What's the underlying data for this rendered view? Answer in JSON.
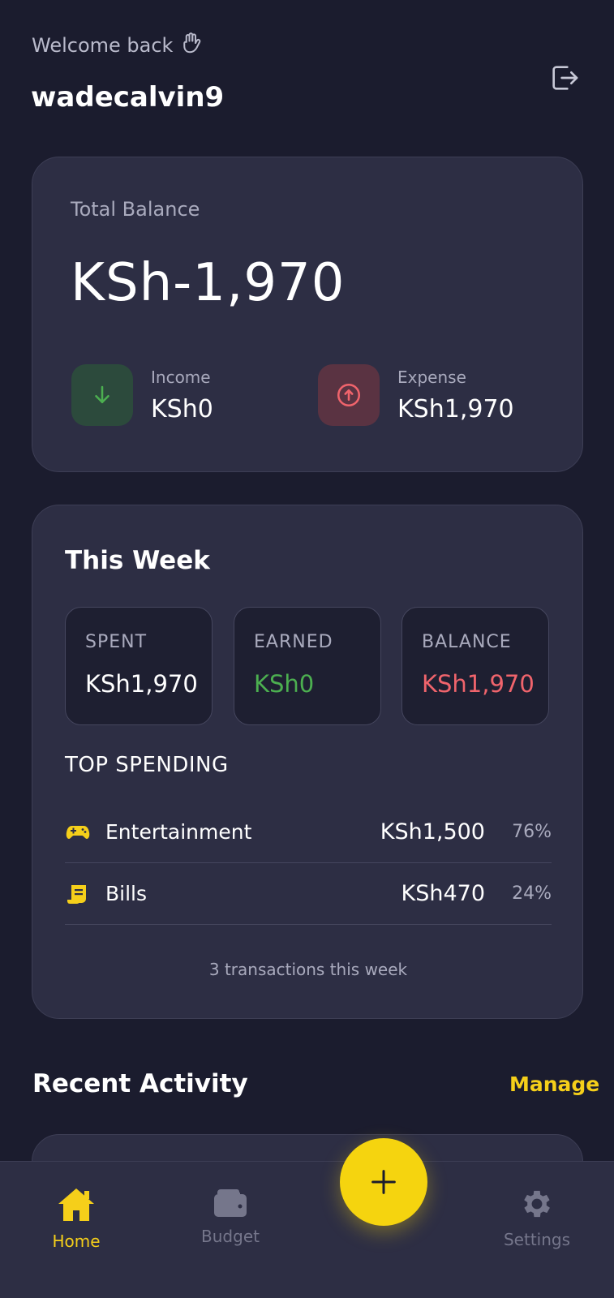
{
  "header": {
    "welcome": "Welcome back",
    "username": "wadecalvin9"
  },
  "balance": {
    "label": "Total Balance",
    "amount": "KSh-1,970",
    "income_label": "Income",
    "income_value": "KSh0",
    "expense_label": "Expense",
    "expense_value": "KSh1,970"
  },
  "week": {
    "title": "This Week",
    "spent_label": "SPENT",
    "spent_value": "KSh1,970",
    "earned_label": "EARNED",
    "earned_value": "KSh0",
    "balance_label": "BALANCE",
    "balance_value": "KSh1,970",
    "top_title": "TOP SPENDING",
    "top": [
      {
        "name": "Entertainment",
        "amount": "KSh1,500",
        "pct": "76%",
        "icon": "gamepad-icon"
      },
      {
        "name": "Bills",
        "amount": "KSh470",
        "pct": "24%",
        "icon": "receipt-icon"
      }
    ],
    "tx_count": "3 transactions this week"
  },
  "recent": {
    "title": "Recent Activity",
    "manage": "Manage"
  },
  "nav": {
    "home": "Home",
    "budget": "Budget",
    "settings": "Settings"
  },
  "colors": {
    "accent": "#f5cf1a",
    "background": "#1b1c2e",
    "card": "#2d2e44",
    "income": "#4caf50",
    "expense": "#f0646c"
  }
}
